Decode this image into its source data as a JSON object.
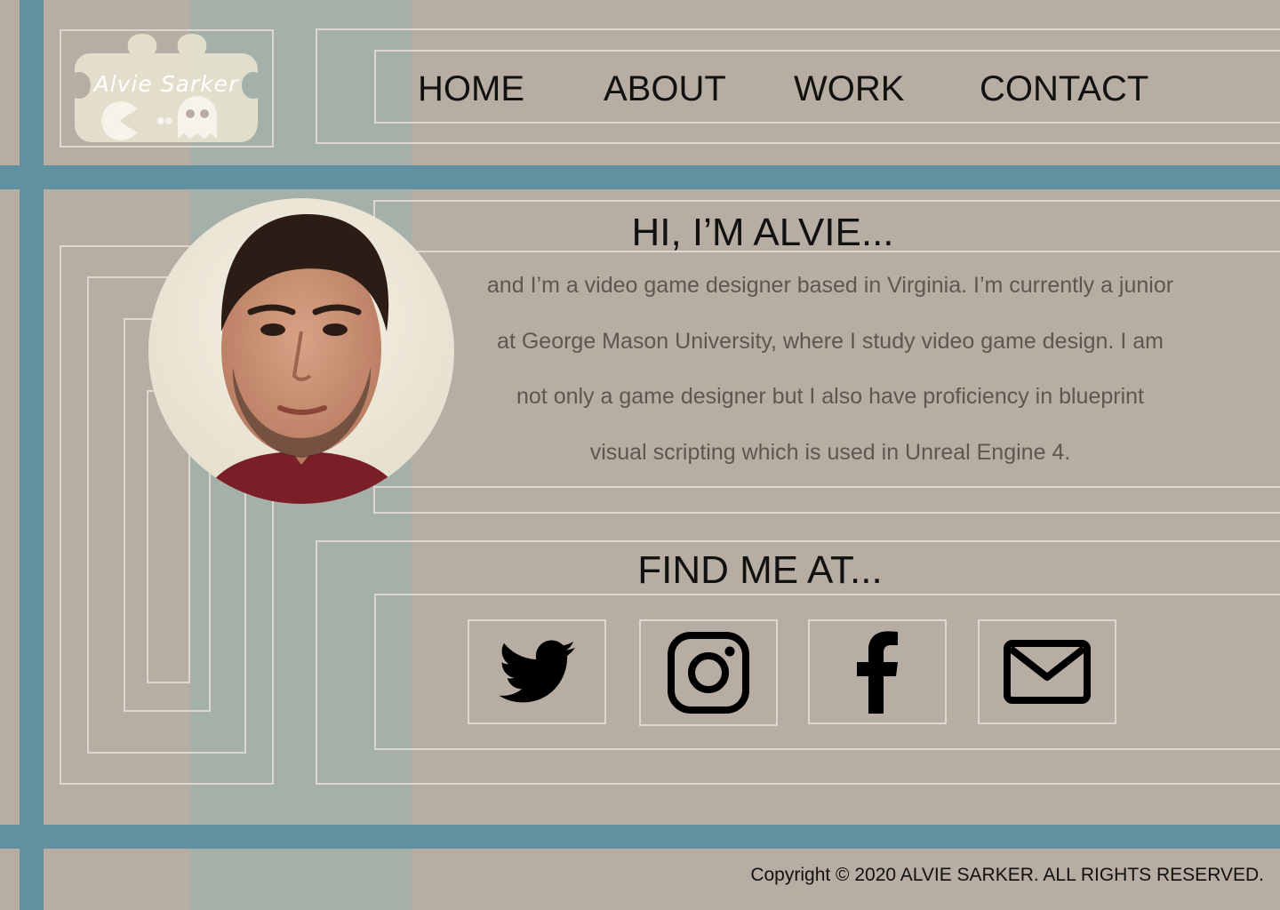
{
  "brand": {
    "name": "Alvie Sarker"
  },
  "nav": {
    "items": [
      {
        "label": "HOME"
      },
      {
        "label": "ABOUT"
      },
      {
        "label": "WORK"
      },
      {
        "label": "CONTACT"
      }
    ]
  },
  "about": {
    "heading": "HI, I’M ALVIE...",
    "lines": [
      "and I’m a video game designer based in Virginia. I’m currently a junior",
      "at George Mason University, where I study video game design.  I am",
      "not only a game designer but I also have proficiency in blueprint",
      "visual scripting which is used in Unreal Engine 4."
    ]
  },
  "social": {
    "heading": "FIND ME AT...",
    "links": [
      {
        "icon": "twitter-icon"
      },
      {
        "icon": "instagram-icon"
      },
      {
        "icon": "facebook-icon"
      },
      {
        "icon": "mail-icon"
      }
    ]
  },
  "footer": {
    "copyright": "Copyright © 2020 ALVIE SARKER. ALL RIGHTS RESERVED."
  },
  "colors": {
    "background": "#b8ada2",
    "accent_bar": "#5f91a0",
    "column_tint": "#a5b1a8",
    "frame_line": "#dcd8d1",
    "text": "#111111",
    "body_text": "#5e5750"
  }
}
